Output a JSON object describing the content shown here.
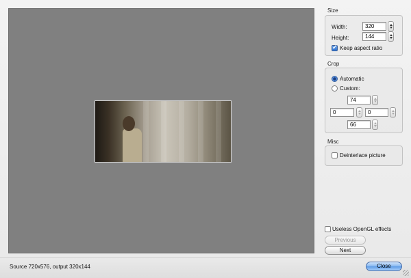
{
  "size": {
    "title": "Size",
    "width_label": "Width:",
    "width_value": "320",
    "height_label": "Height:",
    "height_value": "144",
    "keep_aspect_label": "Keep aspect ratio",
    "keep_aspect_checked": true
  },
  "crop": {
    "title": "Crop",
    "automatic_label": "Automatic",
    "custom_label": "Custom:",
    "selected_mode": "Automatic",
    "top_value": "74",
    "left_value": "0",
    "right_value": "0",
    "bottom_value": "66"
  },
  "misc": {
    "title": "Misc",
    "deinterlace_label": "Deinterlace picture",
    "deinterlace_checked": false
  },
  "options": {
    "opengl_label": "Useless OpenGL effects",
    "opengl_checked": false
  },
  "buttons": {
    "previous_label": "Previous",
    "next_label": "Next",
    "close_label": "Close"
  },
  "status": {
    "text": "Source 720x576, output 320x144"
  },
  "icons": {
    "stepper": "stepper-arrows-icon",
    "resize": "resize-grip-icon"
  },
  "colors": {
    "preview_background": "#808080",
    "primary_button": "#5d9be6"
  }
}
